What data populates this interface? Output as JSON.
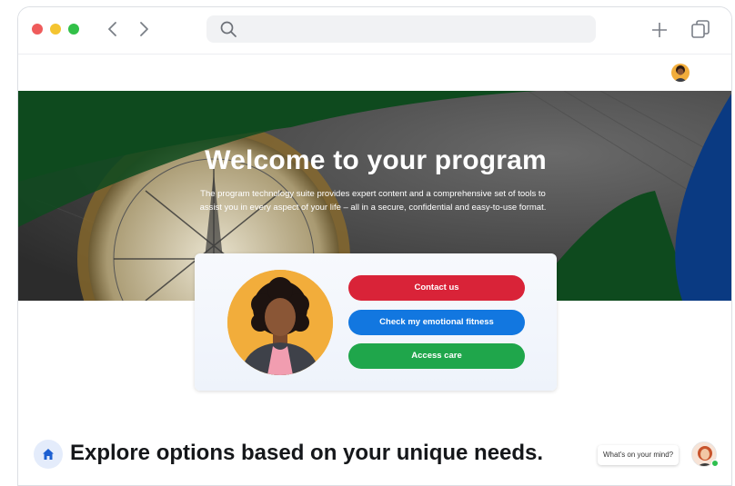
{
  "browser": {
    "address_placeholder": ""
  },
  "hero": {
    "title": "Welcome to your program",
    "subtitle": "The program technology suite provides expert content and a comprehensive set of tools to assist you in every aspect of your life – all in a secure, confidential and easy-to-use format."
  },
  "actions": {
    "contact_label": "Contact us",
    "fitness_label": "Check my emotional fitness",
    "care_label": "Access care"
  },
  "explore": {
    "heading": "Explore options based on your unique needs."
  },
  "chat": {
    "prompt": "What's on your mind?"
  },
  "colors": {
    "contact": "#d92338",
    "fitness": "#1277e0",
    "care": "#1fa64b",
    "hero_green": "#0e4a1e",
    "hero_blue": "#0a3a82"
  },
  "icons": [
    "back-icon",
    "forward-icon",
    "search-icon",
    "plus-icon",
    "tabs-icon",
    "home-icon",
    "user-avatar",
    "chat-assistant-avatar"
  ]
}
